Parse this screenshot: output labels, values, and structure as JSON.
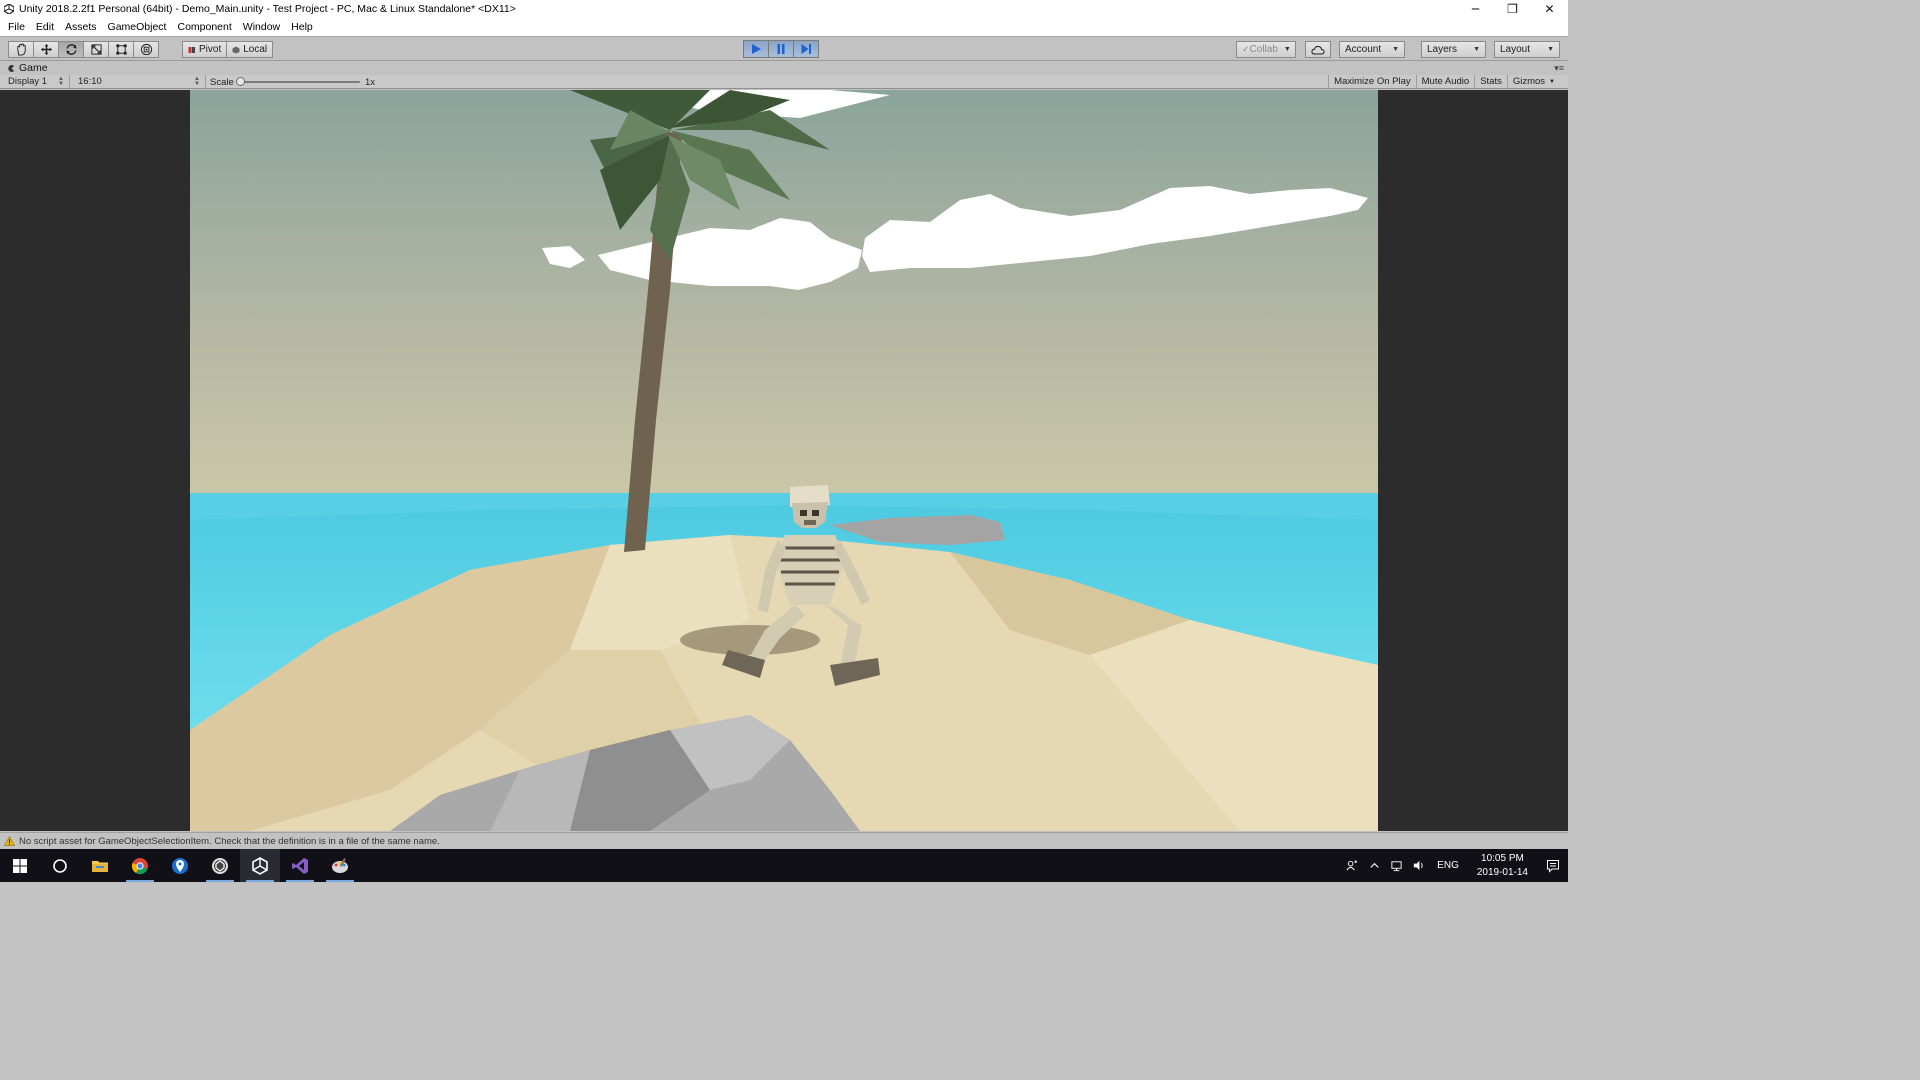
{
  "window": {
    "title": "Unity 2018.2.2f1 Personal (64bit) - Demo_Main.unity - Test Project - PC, Mac & Linux Standalone* <DX11>",
    "controls": {
      "minimize": "─",
      "restore": "❐",
      "close": "✕"
    }
  },
  "menu": [
    "File",
    "Edit",
    "Assets",
    "GameObject",
    "Component",
    "Window",
    "Help"
  ],
  "toolbar": {
    "transform_tools": [
      "hand-tool",
      "move-tool",
      "rotate-tool",
      "scale-tool",
      "rect-tool",
      "transform-tool"
    ],
    "active_tool": "rotate-tool",
    "pivot_label": "Pivot",
    "local_label": "Local",
    "play_active": true,
    "collab_label": "Collab",
    "account_label": "Account",
    "layers_label": "Layers",
    "layout_label": "Layout"
  },
  "game_tab": {
    "label": "Game",
    "menu_glyph": "▾≡"
  },
  "game_bar": {
    "display": "Display 1",
    "aspect": "16:10",
    "scale_label": "Scale",
    "scale_value": "1x",
    "scale_level": 0.0,
    "toggles": [
      "Maximize On Play",
      "Mute Audio",
      "Stats",
      "Gizmos"
    ]
  },
  "console": {
    "message": "No script asset for GameObjectSelectionItem. Check that the definition is in a file of the same name."
  },
  "taskbar": {
    "apps": [
      "windows-start",
      "cortana-search",
      "file-explorer",
      "chrome",
      "maps",
      "unity-hub",
      "unity-editor",
      "visual-studio",
      "paint"
    ],
    "language": "ENG",
    "time": "10:05 PM",
    "date": "2019-01-14"
  },
  "colors": {
    "sky_top": "#8ea69d",
    "sky_bottom": "#c9c6a7",
    "sea": "#5fd4e6",
    "sand": "#e9dbb7",
    "rock": "#a9a9a9",
    "palm_leaf": "#4e6b44",
    "play_blue": "#2b6fd6"
  }
}
